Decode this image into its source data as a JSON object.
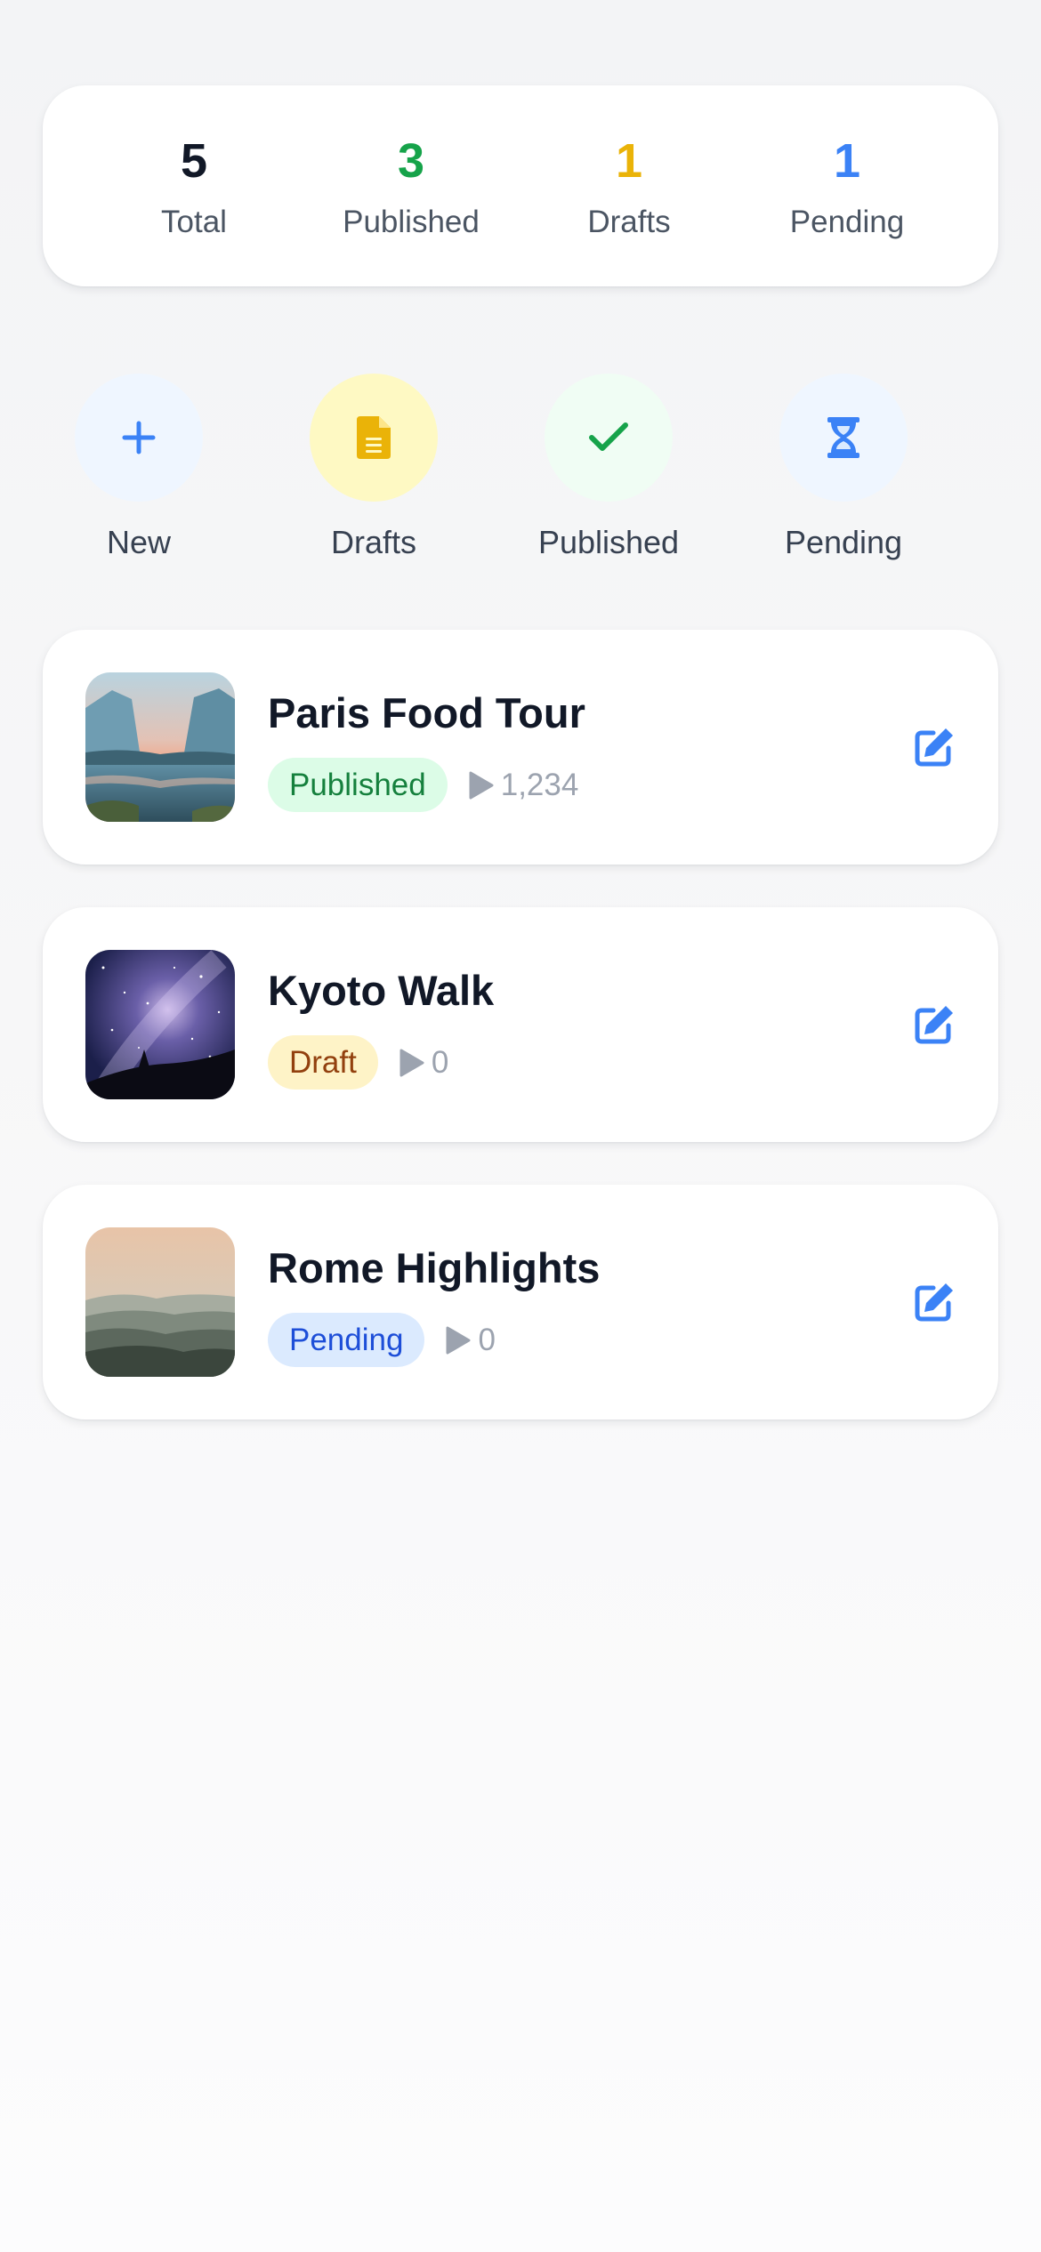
{
  "stats": [
    {
      "value": "5",
      "label": "Total",
      "color": "#111827"
    },
    {
      "value": "3",
      "label": "Published",
      "color": "#16a34a"
    },
    {
      "value": "1",
      "label": "Drafts",
      "color": "#eab308"
    },
    {
      "value": "1",
      "label": "Pending",
      "color": "#3b82f6"
    }
  ],
  "actions": [
    {
      "label": "New",
      "icon": "plus-icon",
      "bg": "#eff6ff",
      "fg": "#3b82f6"
    },
    {
      "label": "Drafts",
      "icon": "document-icon",
      "bg": "#fef9c3",
      "fg": "#eab308"
    },
    {
      "label": "Published",
      "icon": "check-icon",
      "bg": "#f0fdf4",
      "fg": "#16a34a"
    },
    {
      "label": "Pending",
      "icon": "hourglass-icon",
      "bg": "#eff6ff",
      "fg": "#3b82f6"
    }
  ],
  "tours": [
    {
      "title": "Paris Food Tour",
      "status": "Published",
      "plays": "1,234",
      "thumbnail": "mountain-lake-image"
    },
    {
      "title": "Kyoto Walk",
      "status": "Draft",
      "plays": "0",
      "thumbnail": "starry-night-image"
    },
    {
      "title": "Rome Highlights",
      "status": "Pending",
      "plays": "0",
      "thumbnail": "misty-hills-image"
    }
  ],
  "icons": {
    "edit": "edit-icon",
    "play": "play-icon"
  },
  "colors": {
    "accent": "#3b82f6"
  }
}
